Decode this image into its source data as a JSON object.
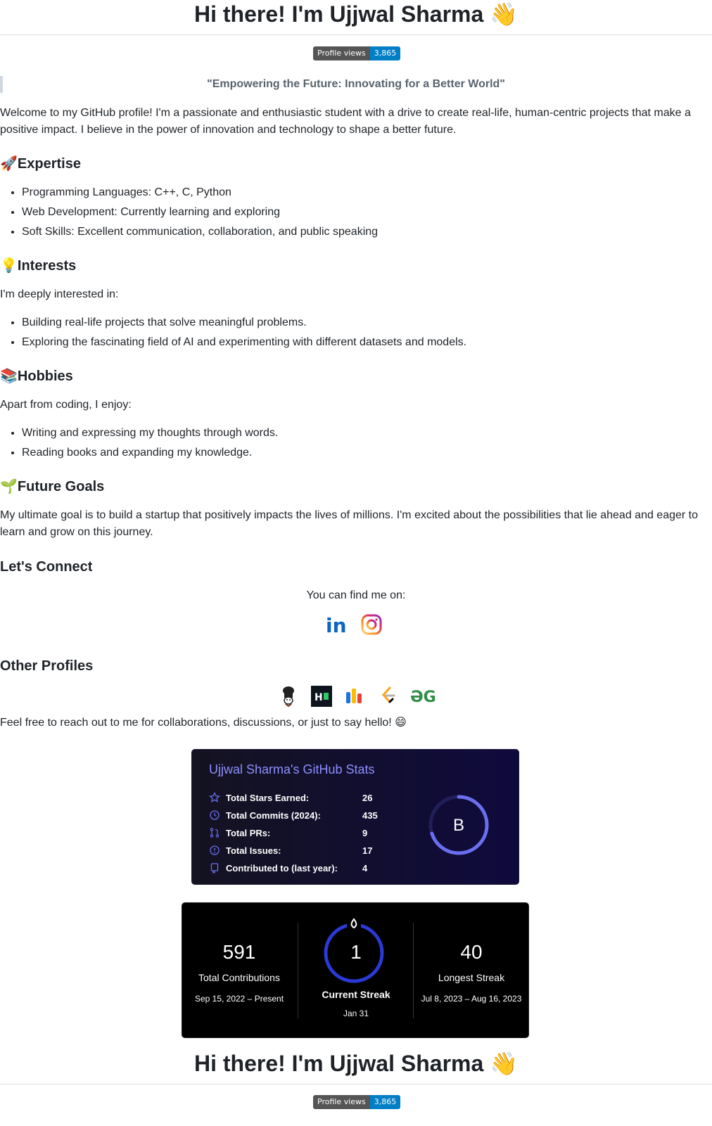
{
  "header": {
    "title": "Hi there! I'm Ujjwal Sharma",
    "wave_emoji": "👋",
    "badge_label": "Profile views",
    "badge_value": "3,865"
  },
  "quote": "\"Empowering the Future: Innovating for a Better World\"",
  "intro": "Welcome to my GitHub profile! I'm a passionate and enthusiastic student with a drive to create real-life, human-centric projects that make a positive impact. I believe in the power of innovation and technology to shape a better future.",
  "expertise": {
    "emoji": "🚀",
    "heading": "Expertise",
    "items": [
      "Programming Languages: C++, C, Python",
      "Web Development: Currently learning and exploring",
      "Soft Skills: Excellent communication, collaboration, and public speaking"
    ]
  },
  "interests": {
    "emoji": "💡",
    "heading": "Interests",
    "intro": "I'm deeply interested in:",
    "items": [
      "Building real-life projects that solve meaningful problems.",
      "Exploring the fascinating field of AI and experimenting with different datasets and models."
    ]
  },
  "hobbies": {
    "emoji": "📚",
    "heading": "Hobbies",
    "intro": "Apart from coding, I enjoy:",
    "items": [
      "Writing and expressing my thoughts through words.",
      "Reading books and expanding my knowledge."
    ]
  },
  "goals": {
    "emoji": "🌱",
    "heading": "Future Goals",
    "text": "My ultimate goal is to build a startup that positively impacts the lives of millions. I'm excited about the possibilities that lie ahead and eager to learn and grow on this journey."
  },
  "connect": {
    "heading": "Let's Connect",
    "text": "You can find me on:",
    "icons": [
      "linkedin-icon",
      "instagram-icon"
    ]
  },
  "other_profiles": {
    "heading": "Other Profiles",
    "icons": [
      "codechef-icon",
      "hackerrank-icon",
      "codolio-icon",
      "leetcode-icon",
      "geeksforgeeks-icon"
    ]
  },
  "reach_out": "Feel free to reach out to me for collaborations, discussions, or just to say hello! 😄",
  "github_stats": {
    "title": "Ujjwal Sharma's GitHub Stats",
    "rows": [
      {
        "label": "Total Stars Earned:",
        "value": "26",
        "icon": "star-icon"
      },
      {
        "label": "Total Commits (2024):",
        "value": "435",
        "icon": "history-icon"
      },
      {
        "label": "Total PRs:",
        "value": "9",
        "icon": "pull-request-icon"
      },
      {
        "label": "Total Issues:",
        "value": "17",
        "icon": "issue-icon"
      },
      {
        "label": "Contributed to (last year):",
        "value": "4",
        "icon": "repo-icon"
      }
    ],
    "rank": "B",
    "rank_progress": 0.7,
    "colors": {
      "bg_start": "#141321",
      "bg_end": "#0f0a3c",
      "title": "#8d8fff",
      "ring": "#6a6ff0"
    }
  },
  "streak": {
    "total": "591",
    "total_label": "Total Contributions",
    "total_range": "Sep 15, 2022 – Present",
    "current": "1",
    "current_label": "Current Streak",
    "current_date": "Jan 31",
    "longest": "40",
    "longest_label": "Longest Streak",
    "longest_range": "Jul 8, 2023 – Aug 16, 2023",
    "colors": {
      "bg": "#000000",
      "ring": "#2a3ad6"
    }
  }
}
